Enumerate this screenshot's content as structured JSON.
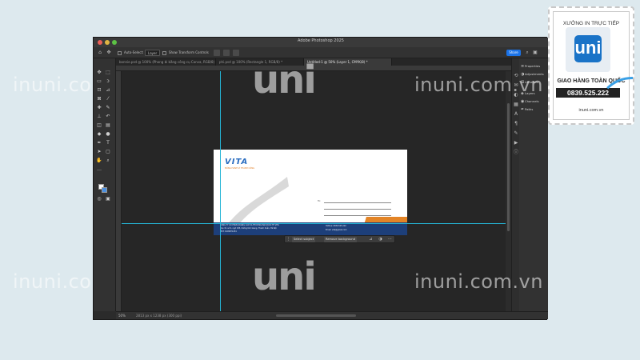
{
  "window": {
    "title": "Adobe Photoshop 2025"
  },
  "options_bar": {
    "auto_select_label": "Auto-Select:",
    "auto_select_value": "Layer",
    "transform_label": "Show Transform Controls",
    "share_label": "Share"
  },
  "tabs": [
    {
      "label": "bonnie.psd @ 100% (Phong bì bằng công cụ Canva, RGB/8)"
    },
    {
      "label": "phi.psd @ 100% (Rectangle 1, RGB/8) *"
    },
    {
      "label": "Untitled-1 @ 50% (Layer 1, CMYK/8) *"
    }
  ],
  "envelope": {
    "logo": "VITA",
    "tagline": "ĐỒNG HÀNH VÌ THÀNH CÔNG",
    "to_label": "To:",
    "footer_lines": [
      "CÔNG TY CỔ PHẦN QUẢNG CÁO VÀ THƯƠNG MẠI QUỐC TẾ VITA",
      "Địa chỉ: số 4, ngõ 138, đường Kim Giang, Thanh Xuân, Hà Nội",
      "MST: 0109871234"
    ],
    "footer_right": [
      "Hotline: 0839.525.222",
      "Email: vita@gmail.com"
    ]
  },
  "context_bar": {
    "select_subject": "Select subject",
    "remove_background": "Remove background"
  },
  "status": {
    "zoom": "50%",
    "info": "2813 px x 1238 px (300 ppi)"
  },
  "panels": [
    {
      "icon": "properties-icon",
      "label": "Properties"
    },
    {
      "icon": "adjustments-icon",
      "label": "Adjustments"
    },
    {
      "icon": "libraries-icon",
      "label": "Libraries"
    },
    {
      "icon": "layers-icon",
      "label": "Layers"
    },
    {
      "icon": "channels-icon",
      "label": "Channels"
    },
    {
      "icon": "paths-icon",
      "label": "Paths"
    }
  ],
  "watermarks": {
    "site": "inuni.com.vn",
    "logo": "uni"
  },
  "badge": {
    "top": "XƯỞNG IN TRỰC TIẾP",
    "logo": "uni",
    "subtitle": "GIAO HÀNG TOÀN QUỐC",
    "phone": "0839.525.222",
    "url": "inuni.com.vn"
  },
  "colors": {
    "guide": "#25b5d6",
    "accent": "#1b73e8",
    "envelope_blue": "#1d3f7a",
    "envelope_orange": "#e38426"
  }
}
